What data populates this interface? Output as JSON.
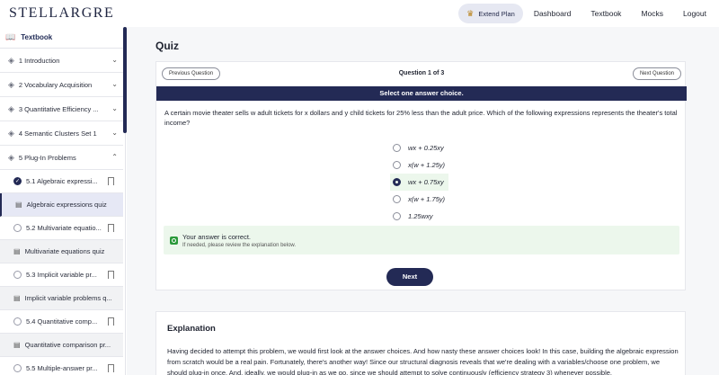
{
  "logo": "STELLARGRE",
  "nav": {
    "extend_plan": "Extend Plan",
    "links": [
      "Dashboard",
      "Textbook",
      "Mocks",
      "Logout"
    ]
  },
  "sidebar": {
    "header": "Textbook",
    "chapters": [
      {
        "label": "1 Introduction"
      },
      {
        "label": "2 Vocabulary Acquisition"
      },
      {
        "label": "3 Quantitative Efficiency ..."
      },
      {
        "label": "4 Semantic Clusters Set 1"
      },
      {
        "label": "5 Plug-In Problems"
      }
    ],
    "lessons": [
      {
        "label": "5.1 Algebraic expressi..."
      },
      {
        "label": "Algebraic expressions quiz"
      },
      {
        "label": "5.2 Multivariate equatio..."
      },
      {
        "label": "Multivariate equations quiz"
      },
      {
        "label": "5.3 Implicit variable pr..."
      },
      {
        "label": "Implicit variable problems q..."
      },
      {
        "label": "5.4 Quantitative comp..."
      },
      {
        "label": "Quantitative comparison pr..."
      },
      {
        "label": "5.5 Multiple-answer pr..."
      }
    ]
  },
  "main": {
    "title": "Quiz",
    "prev_label": "Previous Question",
    "next_q_label": "Next Question",
    "question_count": "Question 1 of 3",
    "instruction": "Select one answer choice.",
    "question_text": "A certain movie theater sells w adult tickets for x dollars and y child tickets for 25% less than the adult price. Which of the following expressions represents the theater's total income?",
    "choices": [
      "wx + 0.25xy",
      "x(w + 1.25y)",
      "wx + 0.75xy",
      "x(w + 1.75y)",
      "1.25wxy"
    ],
    "feedback_title": "Your answer is correct.",
    "feedback_sub": "If needed, please review the explanation below.",
    "next_label": "Next",
    "explanation_title": "Explanation",
    "explanation_text": "Having decided to attempt this problem, we would first look at the answer choices. And how nasty these answer choices look! In this case, building the algebraic expression from scratch would be a real pain. Fortunately, there's another way! Since our structural diagnosis reveals that we're dealing with a variables/choose one problem, we should plug-in once. And, ideally, we would plug-in as we go, since we should attempt to solve continuously (efficiency strategy 3) whenever possible."
  }
}
